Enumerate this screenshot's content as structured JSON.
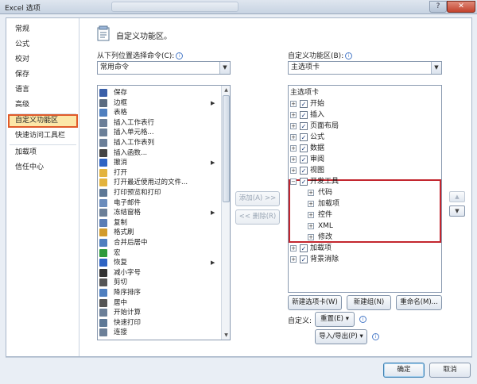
{
  "window": {
    "title": "Excel 选项",
    "help": "?",
    "close": "✕"
  },
  "nav": {
    "items": [
      {
        "label": "常规"
      },
      {
        "label": "公式"
      },
      {
        "label": "校对"
      },
      {
        "label": "保存"
      },
      {
        "label": "语言"
      },
      {
        "label": "高级"
      },
      {
        "label": "自定义功能区",
        "selected": true
      },
      {
        "label": "快速访问工具栏"
      },
      {
        "label": "加载项"
      },
      {
        "label": "信任中心"
      }
    ]
  },
  "header": {
    "title": "自定义功能区。"
  },
  "left_panel": {
    "choose_label": "从下列位置选择命令(C):",
    "choose_value": "常用命令",
    "commands": [
      {
        "label": "保存",
        "icon": "save-icon",
        "color": "#3a5fa8"
      },
      {
        "label": "边框",
        "icon": "border-icon",
        "color": "#5a6b80",
        "sub": true
      },
      {
        "label": "表格",
        "icon": "table-icon",
        "color": "#4f7fbf"
      },
      {
        "label": "插入工作表行",
        "icon": "insert-row-icon",
        "color": "#6b7f98"
      },
      {
        "label": "插入单元格...",
        "icon": "insert-cell-icon",
        "color": "#6b7f98"
      },
      {
        "label": "插入工作表列",
        "icon": "insert-col-icon",
        "color": "#6b7f98"
      },
      {
        "label": "插入函数...",
        "icon": "function-icon",
        "color": "#444444"
      },
      {
        "label": "撤消",
        "icon": "undo-icon",
        "color": "#2f64c3",
        "sub": true
      },
      {
        "label": "打开",
        "icon": "open-icon",
        "color": "#e3b33d"
      },
      {
        "label": "打开最近使用过的文件...",
        "icon": "recent-file-icon",
        "color": "#e3b33d"
      },
      {
        "label": "打印预览和打印",
        "icon": "print-preview-icon",
        "color": "#5d7896"
      },
      {
        "label": "电子邮件",
        "icon": "email-icon",
        "color": "#6a8cbc"
      },
      {
        "label": "冻结窗格",
        "icon": "freeze-panes-icon",
        "color": "#6b7f98",
        "sub": true
      },
      {
        "label": "复制",
        "icon": "copy-icon",
        "color": "#5b7db5"
      },
      {
        "label": "格式刷",
        "icon": "format-painter-icon",
        "color": "#d29b2c"
      },
      {
        "label": "合并后居中",
        "icon": "merge-center-icon",
        "color": "#4f7fbf"
      },
      {
        "label": "宏",
        "icon": "macro-icon",
        "color": "#2f9a3c"
      },
      {
        "label": "恢复",
        "icon": "redo-icon",
        "color": "#2f64c3",
        "sub": true
      },
      {
        "label": "减小字号",
        "icon": "decrease-font-icon",
        "color": "#333333"
      },
      {
        "label": "剪切",
        "icon": "cut-icon",
        "color": "#555555"
      },
      {
        "label": "降序排序",
        "icon": "sort-desc-icon",
        "color": "#4f7fbf"
      },
      {
        "label": "居中",
        "icon": "center-align-icon",
        "color": "#555555"
      },
      {
        "label": "开始计算",
        "icon": "calculate-icon",
        "color": "#6b7f98"
      },
      {
        "label": "快速打印",
        "icon": "quick-print-icon",
        "color": "#5d7896"
      },
      {
        "label": "连接",
        "icon": "connections-icon",
        "color": "#6b7f98"
      }
    ]
  },
  "middle": {
    "add": "添加(A) >>",
    "remove": "<< 删除(R)"
  },
  "right_panel": {
    "customize_label": "自定义功能区(B):",
    "customize_value": "主选项卡",
    "tree_header": "主选项卡",
    "tree": [
      {
        "label": "开始",
        "level": 0,
        "expander": "+",
        "checked": true
      },
      {
        "label": "插入",
        "level": 0,
        "expander": "+",
        "checked": true
      },
      {
        "label": "页面布局",
        "level": 0,
        "expander": "+",
        "checked": true
      },
      {
        "label": "公式",
        "level": 0,
        "expander": "+",
        "checked": true
      },
      {
        "label": "数据",
        "level": 0,
        "expander": "+",
        "checked": true
      },
      {
        "label": "审阅",
        "level": 0,
        "expander": "+",
        "checked": true
      },
      {
        "label": "视图",
        "level": 0,
        "expander": "+",
        "checked": true
      },
      {
        "label": "开发工具",
        "level": 0,
        "expander": "−",
        "checked": true
      },
      {
        "label": "代码",
        "level": 1,
        "expander": "+"
      },
      {
        "label": "加载项",
        "level": 1,
        "expander": "+"
      },
      {
        "label": "控件",
        "level": 1,
        "expander": "+"
      },
      {
        "label": "XML",
        "level": 1,
        "expander": "+"
      },
      {
        "label": "修改",
        "level": 1,
        "expander": "+"
      },
      {
        "label": "加载项",
        "level": 0,
        "expander": "+",
        "checked": true
      },
      {
        "label": "背景消除",
        "level": 0,
        "expander": "+",
        "checked": true
      }
    ],
    "new_tab": "新建选项卡(W)",
    "new_group": "新建组(N)",
    "rename": "重命名(M)...",
    "customize_caption": "自定义:",
    "reset": "重置(E) ▾",
    "import_export": "导入/导出(P) ▾"
  },
  "footer": {
    "ok": "确定",
    "cancel": "取消"
  },
  "colors": {
    "selected_nav_bg": "#fce7a8",
    "selected_nav_border": "#e05a2a",
    "highlight_box": "#c3262e"
  }
}
